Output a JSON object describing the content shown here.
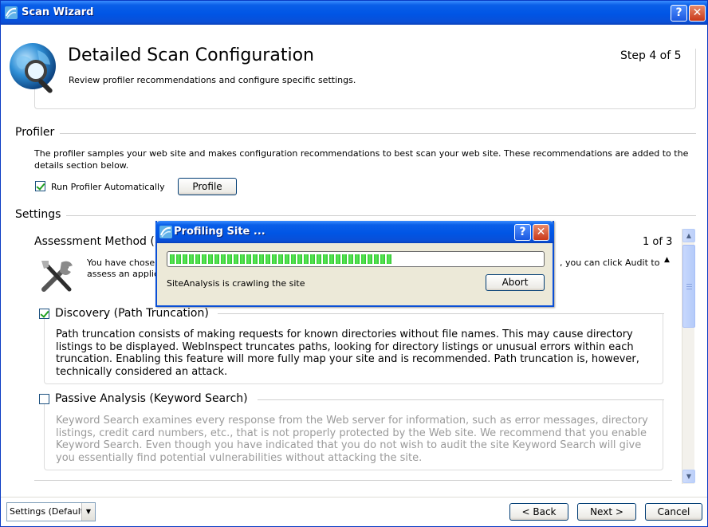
{
  "window": {
    "title": "Scan Wizard"
  },
  "header": {
    "title": "Detailed Scan Configuration",
    "subtitle": "Review profiler recommendations and configure specific settings.",
    "step": "Step 4 of 5"
  },
  "profiler": {
    "section_title": "Profiler",
    "description": "The profiler samples your web site and makes configuration recommendations to best scan your web site. These recommendations are added to the details section below.",
    "run_auto_label": "Run Profiler Automatically",
    "run_auto_checked": true,
    "profile_button": "Profile"
  },
  "settings": {
    "section_title": "Settings",
    "assessment_title": "Assessment Method (",
    "count": "1 of 3",
    "assessment_desc_line1": "You have chose",
    "assessment_desc_line1_tail": ", you can click Audit to",
    "assessment_desc_line2": "assess an applic",
    "discovery": {
      "title": "Discovery (Path Truncation)",
      "checked": true,
      "text": "Path truncation consists of making requests for known directories without file names. This may cause directory listings to be displayed. WebInspect truncates paths, looking for directory listings or unusual errors within each truncation. Enabling this feature will more fully map your site and is recommended. Path truncation is, however, technically considered an attack."
    },
    "passive": {
      "title": "Passive Analysis (Keyword Search)",
      "checked": false,
      "text": "Keyword Search examines every response from the Web server for information, such as error messages, directory listings, credit card numbers, etc., that is not properly protected by the Web site. We recommend that you enable Keyword Search. Even though you have indicated that you do not wish to audit the site Keyword Search will give you essentially find potential vulnerabilities without attacking the site."
    }
  },
  "footer": {
    "settings_combo": "Settings (Default)",
    "back": "< Back",
    "next": "Next >",
    "cancel": "Cancel"
  },
  "dialog": {
    "title": "Profiling Site ...",
    "progress": 0.6,
    "status": "SiteAnalysis is crawling the site",
    "abort": "Abort"
  },
  "colors": {
    "titlebar": "#0055e5",
    "progress_green": "#31d02f",
    "button_border": "#003c74"
  }
}
